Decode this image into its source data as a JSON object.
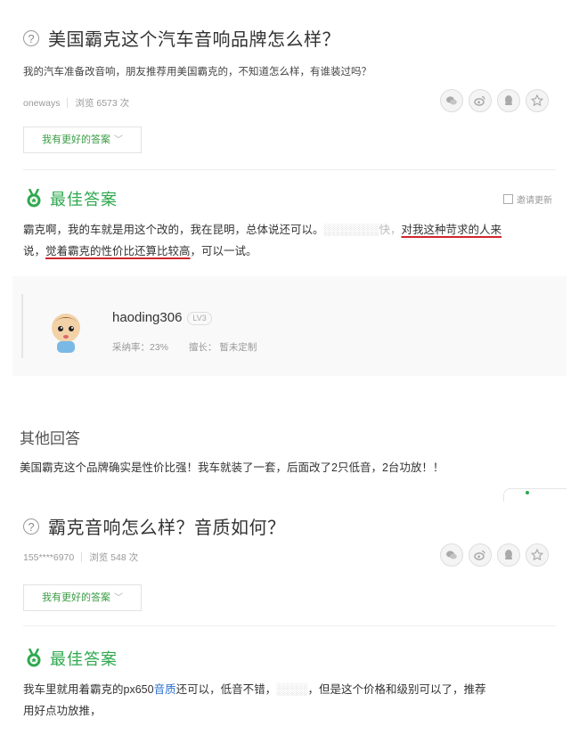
{
  "question1": {
    "title": "美国霸克这个汽车音响品牌怎么样？",
    "description": "我的汽车准备改音响，朋友推荐用美国霸克的，不知道怎么样，有谁装过吗？",
    "author": "oneways",
    "views": "浏览 6573 次",
    "better_answer_button": "我有更好的答案",
    "best_answer_label": "最佳答案",
    "invite_update": "邀请更新",
    "answer_parts": {
      "p1": "霸克啊，我的车就是用这个改的，我在昆明，总体说还可以。",
      "p2": "对我这种苛求的人来",
      "p3": "说，",
      "p4": "觉着霸克的性价比还算比较高",
      "p5": "，可以一试。"
    }
  },
  "answerer": {
    "username": "haoding306",
    "level": "LV3",
    "adoption_rate": "采纳率：23%",
    "expertise": "擅长：  暂未定制"
  },
  "other_answers": {
    "title": "其他回答",
    "answer": "美国霸克这个品牌确实是性价比强！我车就装了一套，后面改了2只低音，2台功放！！"
  },
  "question2": {
    "title": "霸克音响怎么样？音质如何？",
    "author": "155****6970",
    "views": "浏览 548 次",
    "better_answer_button": "我有更好的答案",
    "best_answer_label": "最佳答案",
    "answer_parts": {
      "p1": "我车里就用着霸克的px650",
      "p2": "音质",
      "p3": "还可以，低音不错，",
      "p4": "，但是这个价格和级别可以了，推荐",
      "p5": "用好点功放推，"
    }
  },
  "icons": [
    "question-icon",
    "wechat-icon",
    "weibo-icon",
    "qq-icon",
    "star-icon",
    "medal-icon",
    "edit-icon",
    "chevron-down-icon"
  ],
  "colors": {
    "accent_green": "#2ea84e",
    "underline_red": "#d0262c",
    "link_blue": "#2e6fd0"
  }
}
